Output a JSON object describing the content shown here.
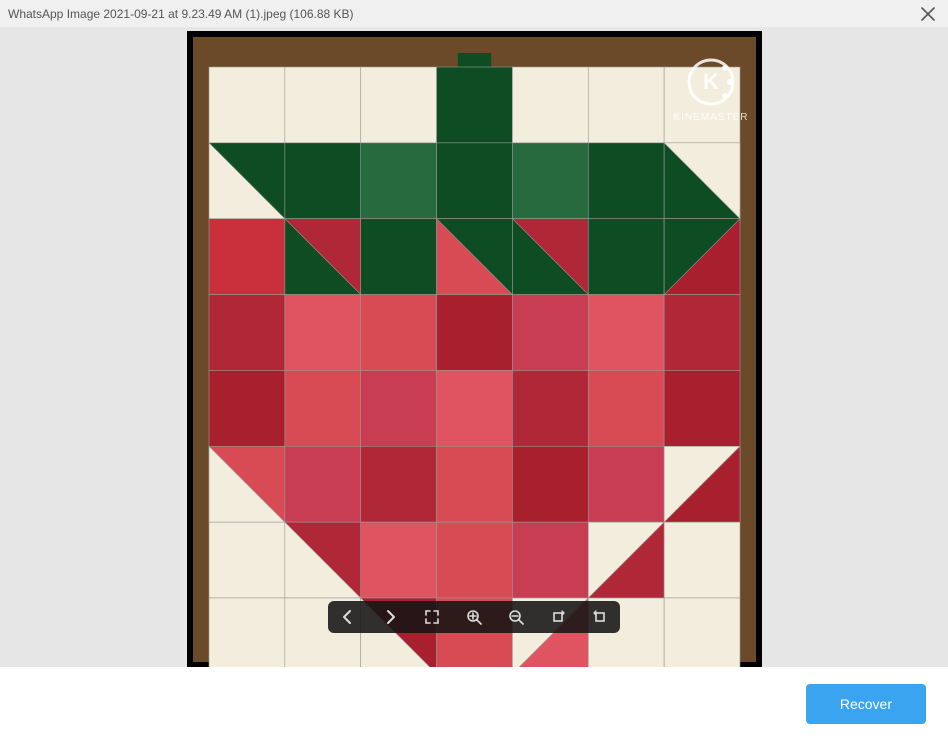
{
  "header": {
    "file_title": "WhatsApp Image 2021-09-21 at 9.23.49 AM (1).jpeg (106.88 KB)",
    "close_label": "Close"
  },
  "image": {
    "watermark_letter": "K",
    "watermark_text": "KINEMASTER"
  },
  "toolbar": {
    "items": [
      {
        "name": "prev",
        "label": "Previous"
      },
      {
        "name": "next",
        "label": "Next"
      },
      {
        "name": "fullscreen",
        "label": "Fullscreen"
      },
      {
        "name": "zoom_in",
        "label": "Zoom in"
      },
      {
        "name": "zoom_out",
        "label": "Zoom out"
      },
      {
        "name": "rotate_right",
        "label": "Rotate right"
      },
      {
        "name": "rotate_left",
        "label": "Rotate left"
      }
    ]
  },
  "footer": {
    "recover_label": "Recover"
  },
  "colors": {
    "accent": "#3aa4f0",
    "viewer_bg": "#e6e6e6",
    "titlebar_bg": "#f0f0f0"
  },
  "quilt": {
    "palette": {
      "bg": "#6b4a29",
      "wt": "#f2eddc",
      "gd": "#0e4d24",
      "gp": "#276a3d",
      "r1": "#c9303c",
      "r2": "#b02738",
      "r3": "#d84b55",
      "r4": "#a81f2e",
      "r5": "#c83d52",
      "r6": "#e05360"
    },
    "stem_col": 3,
    "rows": [
      [
        "wt",
        "wt",
        "wt",
        "gd",
        "wt",
        "wt",
        "wt"
      ],
      [
        {
          "hst": [
            "wt",
            "gd"
          ]
        },
        "gd",
        "gp",
        "gd",
        "gp",
        "gd",
        {
          "hst": [
            "gd",
            "wt"
          ]
        }
      ],
      [
        "r1",
        {
          "hst": [
            "gd",
            "r2"
          ]
        },
        "gd",
        {
          "hst": [
            "r3",
            "gd"
          ]
        },
        {
          "hst": [
            "gd",
            "r2"
          ]
        },
        "gd",
        {
          "hst": [
            "r4",
            "gd"
          ],
          "flip": true
        }
      ],
      [
        "r2",
        "r6",
        "r3",
        "r4",
        "r5",
        "r6",
        "r2"
      ],
      [
        "r4",
        "r3",
        "r5",
        "r6",
        "r2",
        "r3",
        "r4"
      ],
      [
        {
          "hst": [
            "r3",
            "wt"
          ],
          "bl": true
        },
        "r5",
        "r2",
        "r3",
        "r4",
        "r5",
        {
          "hst": [
            "wt",
            "r4"
          ],
          "br": true
        }
      ],
      [
        "wt",
        {
          "hst": [
            "r2",
            "wt"
          ],
          "bl": true
        },
        "r6",
        "r3",
        "r5",
        {
          "hst": [
            "wt",
            "r2"
          ],
          "br": true
        },
        "wt"
      ],
      [
        "wt",
        "wt",
        {
          "hst": [
            "r4",
            "wt"
          ],
          "bl": true
        },
        "r3",
        {
          "hst": [
            "wt",
            "r6"
          ],
          "br": true
        },
        "wt",
        "wt"
      ]
    ]
  }
}
